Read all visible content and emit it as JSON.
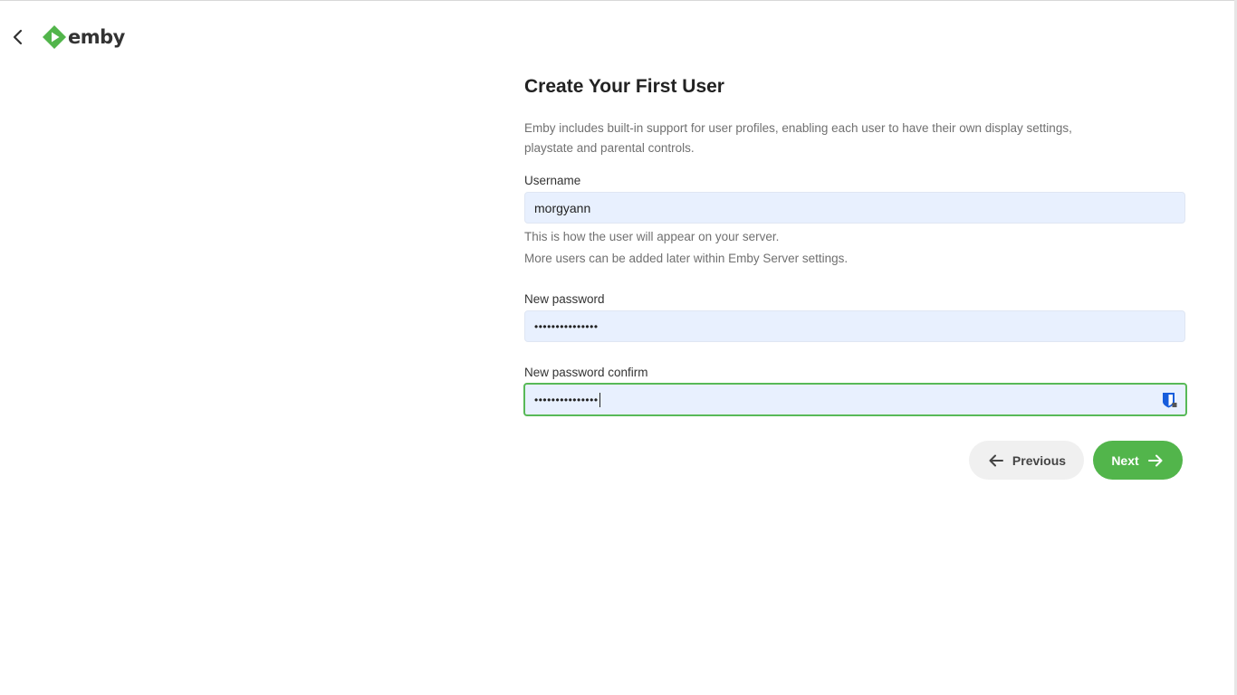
{
  "header": {
    "back_icon": "chevron-left-icon",
    "logo_text": "emby",
    "logo_color": "#52b54b"
  },
  "main": {
    "title": "Create Your First User",
    "intro_line1": "Emby includes built-in support for user profiles, enabling each user to have their own display settings,",
    "intro_line2": "playstate and parental controls.",
    "username": {
      "label": "Username",
      "value": "morgyann",
      "help_line1": "This is how the user will appear on your server.",
      "help_line2": "More users can be added later within Emby Server settings."
    },
    "new_password": {
      "label": "New password",
      "value_masked": "•••••••••••••••"
    },
    "new_password_confirm": {
      "label": "New password confirm",
      "value_masked": "•••••••••••••••",
      "manager_icon": "password-manager-icon"
    }
  },
  "buttons": {
    "previous_label": "Previous",
    "previous_icon": "arrow-left-icon",
    "next_label": "Next",
    "next_icon": "arrow-right-icon",
    "accent_color": "#52b54b"
  }
}
